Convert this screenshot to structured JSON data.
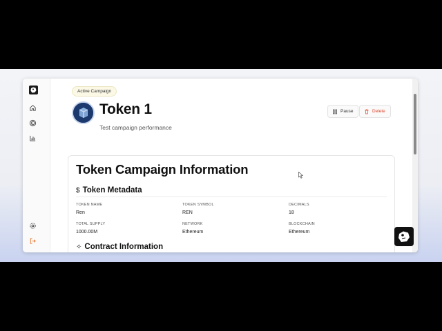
{
  "campaign": {
    "badge": "Active Campaign",
    "title": "Token 1",
    "subtitle": "Test campaign performance"
  },
  "actions": {
    "pause_label": "Pause",
    "delete_label": "Delete"
  },
  "card": {
    "title": "Token Campaign Information",
    "metadata_section": {
      "heading": "Token Metadata",
      "icon": "dollar-icon",
      "fields": [
        {
          "label": "TOKEN NAME",
          "value": "Ren"
        },
        {
          "label": "TOKEN SYMBOL",
          "value": "REN"
        },
        {
          "label": "DECIMALS",
          "value": "18"
        },
        {
          "label": "TOTAL SUPPLY",
          "value": "1000.00M"
        },
        {
          "label": "NETWORK",
          "value": "Ethereum"
        },
        {
          "label": "BLOCKCHAIN",
          "value": "Ethereum"
        }
      ]
    },
    "contract_section": {
      "heading": "Contract Information",
      "icon": "sparkle-icon"
    }
  },
  "sidebar": {
    "icons": [
      "logo-icon",
      "home-icon",
      "target-icon",
      "bar-chart-icon",
      "settings-icon",
      "logout-icon"
    ]
  },
  "colors": {
    "accent_delete": "#e0452a",
    "logout": "#e8742a",
    "badge_bg": "#fbf8e6",
    "avatar_bg": "#1c3a6e"
  }
}
